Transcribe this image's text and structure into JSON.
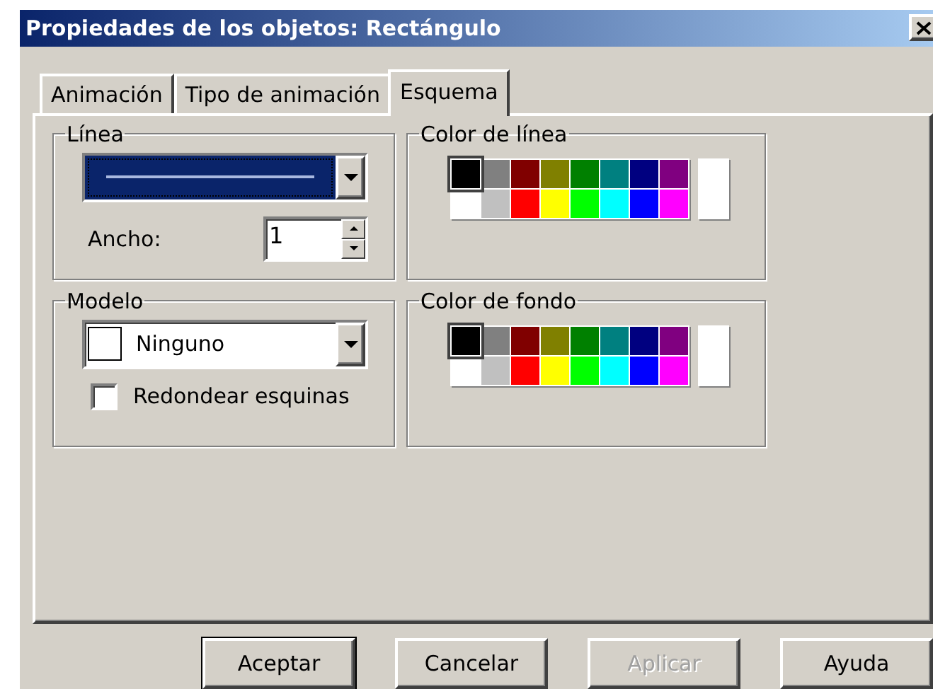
{
  "window": {
    "title": "Propiedades de los objetos: Rectángulo"
  },
  "tabs": [
    {
      "label": "Animación",
      "selected": false
    },
    {
      "label": "Tipo de animación",
      "selected": false
    },
    {
      "label": "Esquema",
      "selected": true
    }
  ],
  "line_group": {
    "title": "Línea",
    "width_label": "Ancho:",
    "width_value": "1"
  },
  "model_group": {
    "title": "Modelo",
    "value": "Ninguno",
    "round_corners": {
      "label": "Redondear esquinas",
      "checked": false
    }
  },
  "palettes": [
    {
      "title": "Color de línea",
      "swatches": [
        {
          "color": "#000000",
          "selected": true
        },
        {
          "color": "#808080",
          "selected": false
        },
        {
          "color": "#800000",
          "selected": false
        },
        {
          "color": "#808000",
          "selected": false
        },
        {
          "color": "#008000",
          "selected": false
        },
        {
          "color": "#008080",
          "selected": false
        },
        {
          "color": "#000080",
          "selected": false
        },
        {
          "color": "#800080",
          "selected": false
        },
        {
          "color": "#ffffff",
          "selected": false
        },
        {
          "color": "#c0c0c0",
          "selected": false
        },
        {
          "color": "#ff0000",
          "selected": false
        },
        {
          "color": "#ffff00",
          "selected": false
        },
        {
          "color": "#00ff00",
          "selected": false
        },
        {
          "color": "#00ffff",
          "selected": false
        },
        {
          "color": "#0000ff",
          "selected": false
        },
        {
          "color": "#ff00ff",
          "selected": false
        }
      ]
    },
    {
      "title": "Color de fondo",
      "swatches": [
        {
          "color": "#000000",
          "selected": true
        },
        {
          "color": "#808080",
          "selected": false
        },
        {
          "color": "#800000",
          "selected": false
        },
        {
          "color": "#808000",
          "selected": false
        },
        {
          "color": "#008000",
          "selected": false
        },
        {
          "color": "#008080",
          "selected": false
        },
        {
          "color": "#000080",
          "selected": false
        },
        {
          "color": "#800080",
          "selected": false
        },
        {
          "color": "#ffffff",
          "selected": false
        },
        {
          "color": "#c0c0c0",
          "selected": false
        },
        {
          "color": "#ff0000",
          "selected": false
        },
        {
          "color": "#ffff00",
          "selected": false
        },
        {
          "color": "#00ff00",
          "selected": false
        },
        {
          "color": "#00ffff",
          "selected": false
        },
        {
          "color": "#0000ff",
          "selected": false
        },
        {
          "color": "#ff00ff",
          "selected": false
        }
      ]
    }
  ],
  "buttons": [
    {
      "label": "Aceptar",
      "default": true,
      "disabled": false
    },
    {
      "label": "Cancelar",
      "default": false,
      "disabled": false
    },
    {
      "label": "Aplicar",
      "default": false,
      "disabled": true
    },
    {
      "label": "Ayuda",
      "default": false,
      "disabled": false
    }
  ]
}
